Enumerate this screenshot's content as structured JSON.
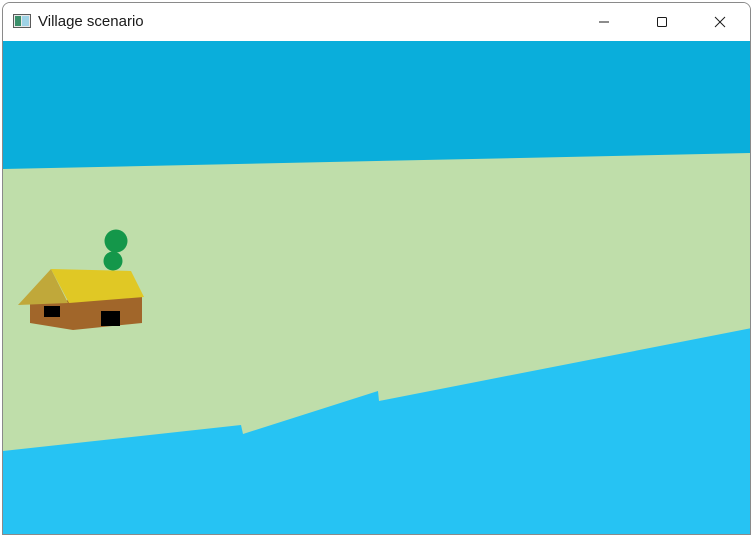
{
  "window": {
    "title": "Village scenario",
    "app_icon": "opengl-window-icon",
    "controls": {
      "minimize_icon": "minimize-icon",
      "maximize_icon": "maximize-icon",
      "close_icon": "close-icon"
    }
  },
  "scene": {
    "colors": {
      "sky": "#0aaedb",
      "grass": "#bfdeaa",
      "water": "#26c3f3",
      "roof_front": "#e0c825",
      "roof_side": "#c0a83a",
      "walls": "#a1662a",
      "windows": "#000000",
      "tree": "#14974a"
    }
  }
}
